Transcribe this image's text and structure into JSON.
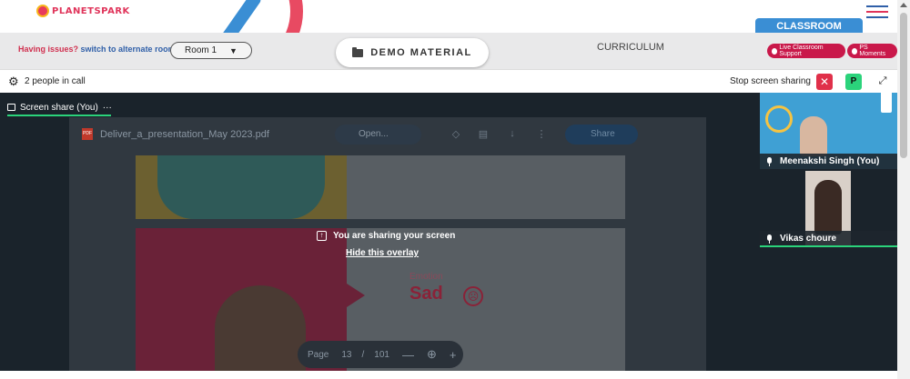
{
  "header": {
    "logo_text": "PLANETSPARK",
    "classroom_label": "CLASSROOM"
  },
  "nav": {
    "issues_text": "Having issues?",
    "alt_room_link": "switch to alternate room",
    "room_value": "Room 1",
    "room_caret": "▼",
    "demo_material_label": "DEMO MATERIAL",
    "curriculum_label": "CURRICULUM",
    "live_support_label": "Live Classroom Support",
    "ps_moments_label": "PS Moments"
  },
  "callbar": {
    "people_count": "2 people in call",
    "stop_label": "Stop screen sharing",
    "stop_icon": "✕",
    "participant_initial": "P",
    "expand_icon": "⤢"
  },
  "stage": {
    "share_tab_label": "Screen share (You)",
    "share_tab_menu": "···",
    "shared_screen": {
      "pdf_badge": "PDF",
      "pdf_title": "Deliver_a_presentation_May 2023.pdf",
      "open_label": "Open...",
      "share_label": "Share",
      "emotion_label": "Emotion",
      "emotion_word": "Sad",
      "emotion_face": "☹"
    },
    "overlay_message": "You are sharing your screen",
    "hide_overlay": "Hide this overlay",
    "pager": {
      "page_label": "Page",
      "current_page": "13",
      "separator": "/",
      "total_pages": "101",
      "zoom_out": "—",
      "zoom_icon": "⊕",
      "zoom_in": "+"
    }
  },
  "participants": [
    {
      "name": "Meenakshi Singh (You)"
    },
    {
      "name": "Vikas choure"
    }
  ]
}
